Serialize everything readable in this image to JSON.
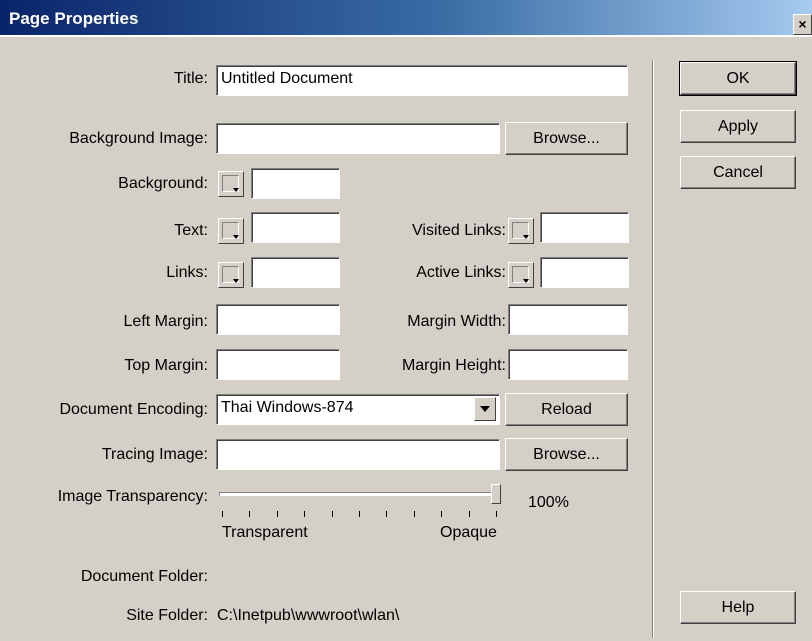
{
  "window": {
    "title": "Page Properties",
    "close_glyph": "×"
  },
  "buttons": {
    "ok": "OK",
    "apply": "Apply",
    "cancel": "Cancel",
    "help": "Help",
    "browse_bg": "Browse...",
    "reload": "Reload",
    "browse_tracing": "Browse..."
  },
  "fields": {
    "title": {
      "label": "Title:",
      "value": "Untitled Document"
    },
    "background_image": {
      "label": "Background Image:",
      "value": ""
    },
    "background": {
      "label": "Background:",
      "value": ""
    },
    "text": {
      "label": "Text:",
      "value": ""
    },
    "visited_links": {
      "label": "Visited Links:",
      "value": ""
    },
    "links": {
      "label": "Links:",
      "value": ""
    },
    "active_links": {
      "label": "Active Links:",
      "value": ""
    },
    "left_margin": {
      "label": "Left Margin:",
      "value": ""
    },
    "margin_width": {
      "label": "Margin Width:",
      "value": ""
    },
    "top_margin": {
      "label": "Top Margin:",
      "value": ""
    },
    "margin_height": {
      "label": "Margin Height:",
      "value": ""
    },
    "document_encoding": {
      "label": "Document Encoding:",
      "value": "Thai Windows-874"
    },
    "tracing_image": {
      "label": "Tracing Image:",
      "value": ""
    }
  },
  "transparency": {
    "label": "Image Transparency:",
    "value_text": "100%",
    "value": 100,
    "min_label": "Transparent",
    "max_label": "Opaque"
  },
  "folders": {
    "document_label": "Document Folder:",
    "document_value": "",
    "site_label": "Site Folder:",
    "site_value": "C:\\Inetpub\\wwwroot\\wlan\\"
  },
  "colors": {
    "dialog_bg": "#d4d0c8",
    "titlebar_start": "#0a246a",
    "titlebar_end": "#a6caf0"
  }
}
